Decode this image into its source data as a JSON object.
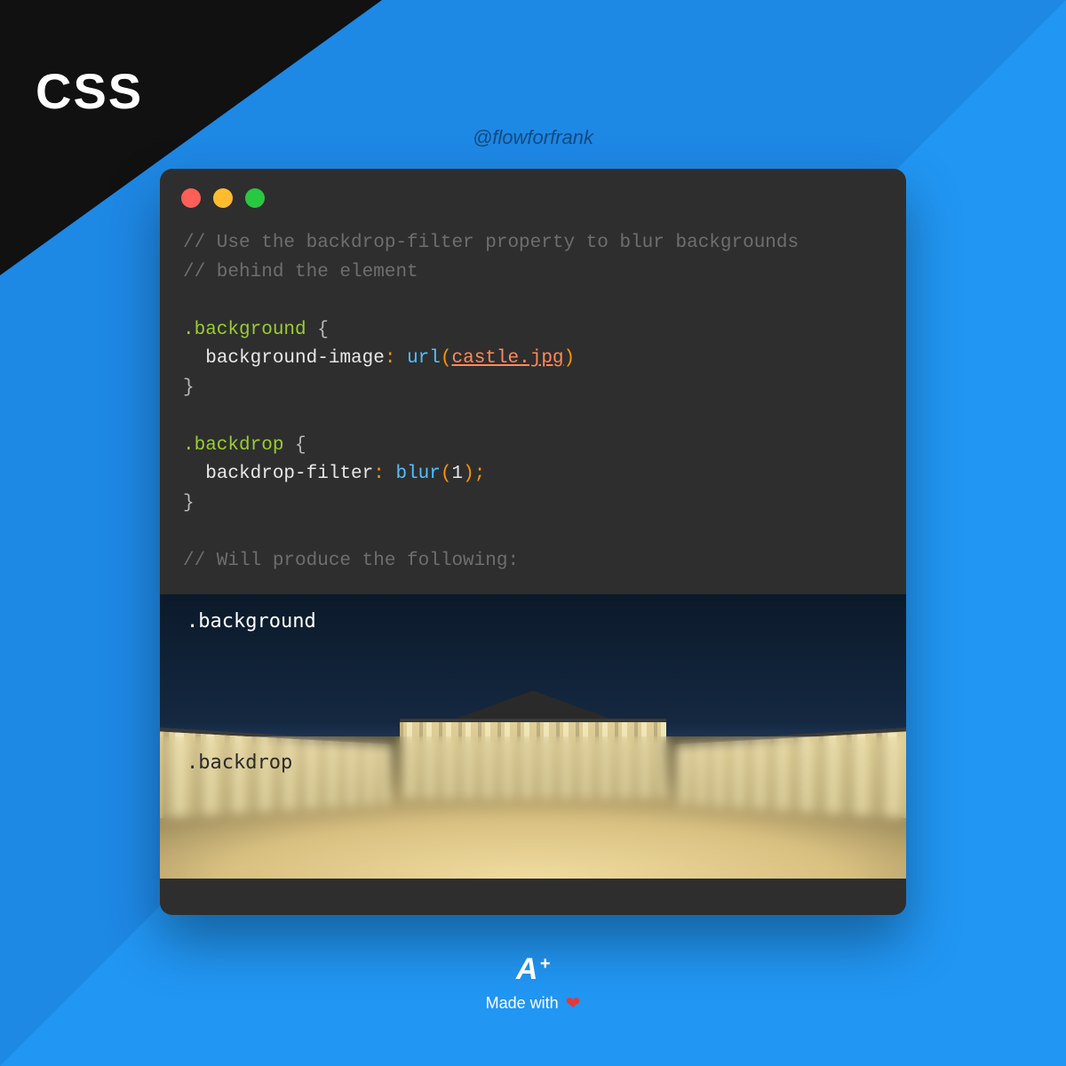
{
  "corner": {
    "label": "CSS"
  },
  "handle": "@flowforfrank",
  "code": {
    "comment1": "// Use the backdrop-filter property to blur backgrounds",
    "comment2": "// behind the element",
    "sel1": ".background",
    "brace_open": "{",
    "brace_close": "}",
    "prop1": "background-image",
    "colon": ":",
    "func_url": "url",
    "paren_open": "(",
    "paren_close": ")",
    "url_arg": "castle.jpg",
    "sel2": ".backdrop",
    "prop2": "backdrop-filter",
    "func_blur": "blur",
    "blur_arg": "1",
    "semi": ";",
    "comment3": "// Will produce the following:"
  },
  "preview": {
    "label_top": ".background",
    "label_bottom": ".backdrop"
  },
  "footer": {
    "logo": "A",
    "logo_plus": "+",
    "made": "Made with",
    "heart": "❤"
  }
}
